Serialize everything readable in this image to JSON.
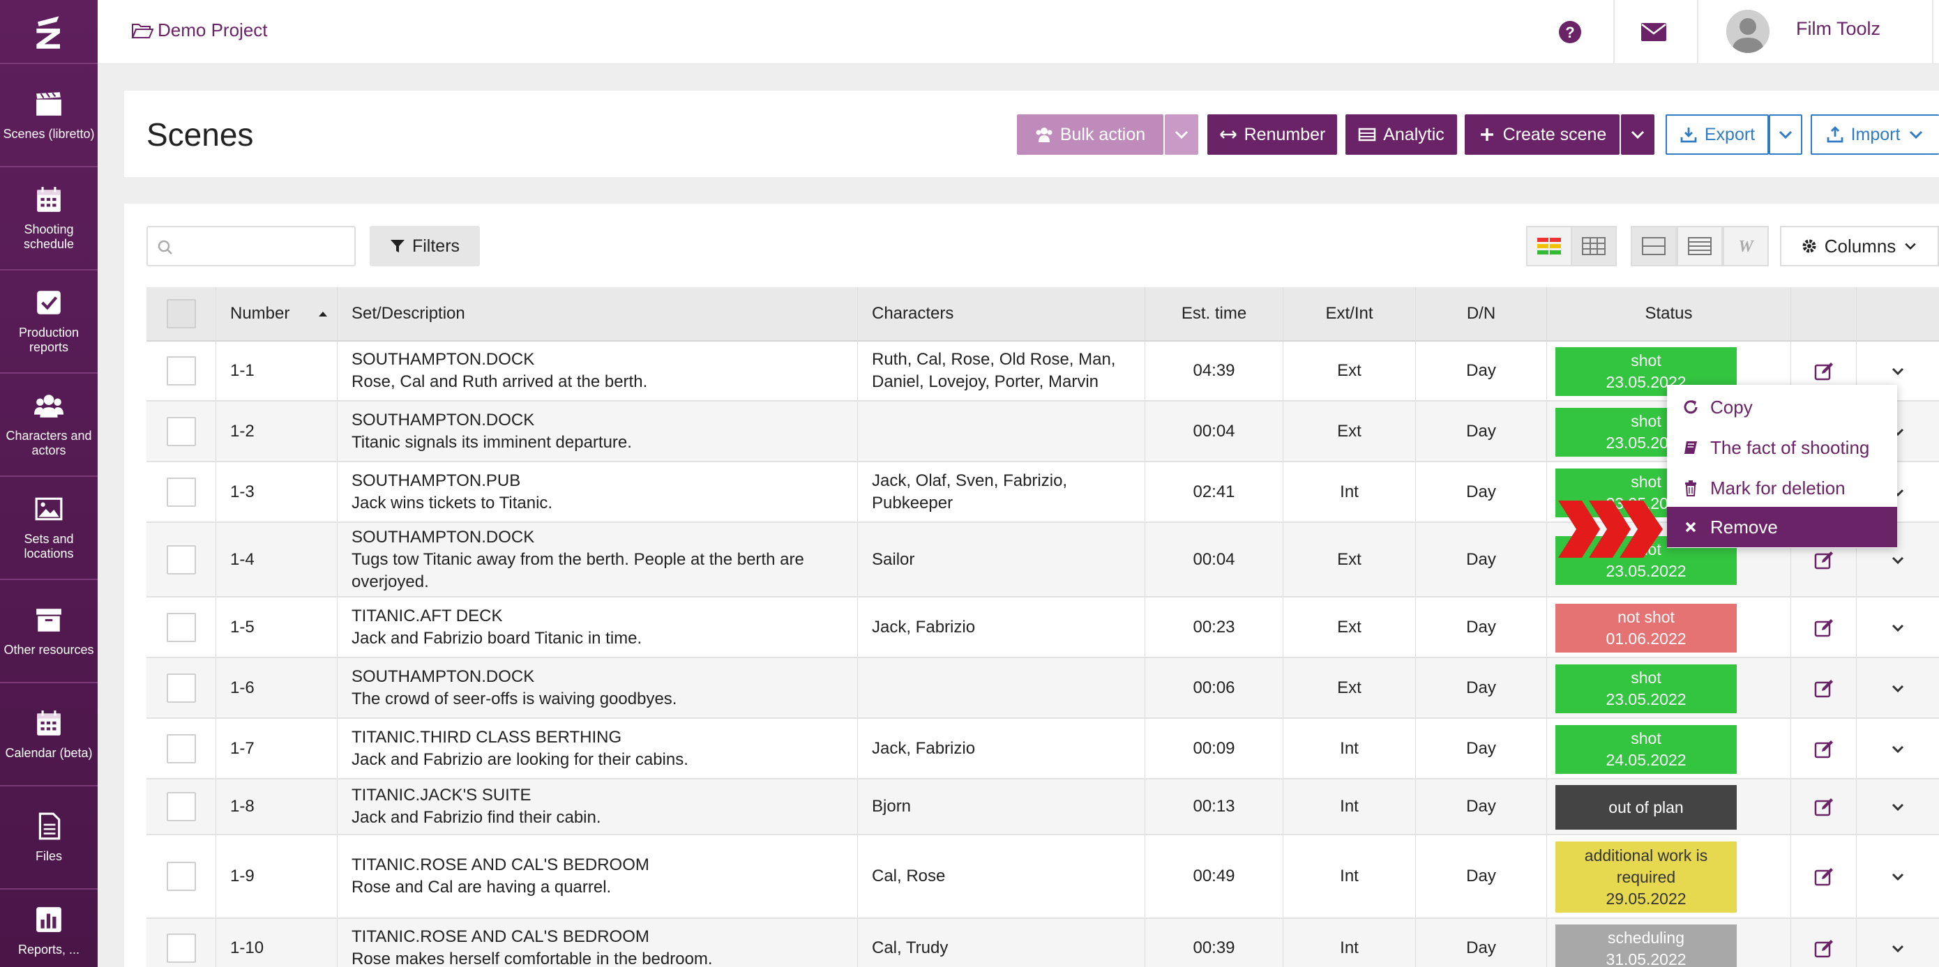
{
  "sidebar": {
    "items": [
      {
        "label": "Scenes (libretto)",
        "icon": "clapperboard-icon"
      },
      {
        "label": "Shooting schedule",
        "icon": "calendar-icon"
      },
      {
        "label": "Production reports",
        "icon": "checkbox-icon"
      },
      {
        "label": "Characters and actors",
        "icon": "users-icon"
      },
      {
        "label": "Sets and locations",
        "icon": "image-icon"
      },
      {
        "label": "Other resources",
        "icon": "archive-icon"
      },
      {
        "label": "Calendar (beta)",
        "icon": "calendar-icon"
      },
      {
        "label": "Files",
        "icon": "file-icon"
      },
      {
        "label": "Reports, ...",
        "icon": "bar-chart-icon"
      }
    ]
  },
  "topbar": {
    "project": "Demo Project",
    "user": "Film Toolz"
  },
  "page": {
    "title": "Scenes",
    "buttons": {
      "bulk": "Bulk action",
      "renumber": "Renumber",
      "analytic": "Analytic",
      "create": "Create scene",
      "export": "Export",
      "import": "Import"
    }
  },
  "toolbar": {
    "search_placeholder": "",
    "filters": "Filters",
    "columns": "Columns"
  },
  "table": {
    "headers": [
      "Number",
      "Set/Description",
      "Characters",
      "Est. time",
      "Ext/Int",
      "D/N",
      "Status"
    ],
    "rows": [
      {
        "number": "1-1",
        "set": "SOUTHAMPTON.DOCK",
        "desc": "Rose, Cal and Ruth arrived at the berth.",
        "chars1": "Ruth, Cal, Rose, Old Rose, Man,",
        "chars2": "Daniel, Lovejoy, Porter, Marvin",
        "time": "04:39",
        "extint": "Ext",
        "dn": "Day",
        "status": "shot",
        "date": "23.05.2022",
        "status_color": "#33c440"
      },
      {
        "number": "1-2",
        "set": "SOUTHAMPTON.DOCK",
        "desc": "Titanic signals its imminent departure.",
        "chars1": "",
        "chars2": "",
        "time": "00:04",
        "extint": "Ext",
        "dn": "Day",
        "status": "shot",
        "date": "23.05.2022",
        "status_color": "#33c440"
      },
      {
        "number": "1-3",
        "set": "SOUTHAMPTON.PUB",
        "desc": "Jack wins tickets to Titanic.",
        "chars1": "Jack, Olaf, Sven, Fabrizio,",
        "chars2": "Pubkeeper",
        "time": "02:41",
        "extint": "Int",
        "dn": "Day",
        "status": "shot",
        "date": "23.05.2022",
        "status_color": "#33c440"
      },
      {
        "number": "1-4",
        "set": "SOUTHAMPTON.DOCK",
        "desc": "Tugs tow Titanic away from the berth. People at the berth are",
        "desc2": "overjoyed.",
        "chars1": "Sailor",
        "chars2": "",
        "time": "00:04",
        "extint": "Ext",
        "dn": "Day",
        "status": "shot",
        "date": "23.05.2022",
        "status_color": "#33c440"
      },
      {
        "number": "1-5",
        "set": "TITANIC.AFT DECK",
        "desc": "Jack and Fabrizio board Titanic in time.",
        "chars1": "Jack, Fabrizio",
        "chars2": "",
        "time": "00:23",
        "extint": "Ext",
        "dn": "Day",
        "status": "not shot",
        "date": "01.06.2022",
        "status_color": "#e57373"
      },
      {
        "number": "1-6",
        "set": "SOUTHAMPTON.DOCK",
        "desc": "The crowd of seer-offs is waiving goodbyes.",
        "chars1": "",
        "chars2": "",
        "time": "00:06",
        "extint": "Ext",
        "dn": "Day",
        "status": "shot",
        "date": "23.05.2022",
        "status_color": "#33c440"
      },
      {
        "number": "1-7",
        "set": "TITANIC.THIRD CLASS BERTHING",
        "desc": "Jack and Fabrizio are looking for their cabins.",
        "chars1": "Jack, Fabrizio",
        "chars2": "",
        "time": "00:09",
        "extint": "Int",
        "dn": "Day",
        "status": "shot",
        "date": "24.05.2022",
        "status_color": "#33c440"
      },
      {
        "number": "1-8",
        "set": "TITANIC.JACK'S SUITE",
        "desc": "Jack and Fabrizio find their cabin.",
        "chars1": "Bjorn",
        "chars2": "",
        "time": "00:13",
        "extint": "Int",
        "dn": "Day",
        "status": "out of plan",
        "date": "",
        "status_color": "#444444"
      },
      {
        "number": "1-9",
        "set": "TITANIC.ROSE AND CAL'S BEDROOM",
        "desc": "Rose and Cal are having a quarrel.",
        "chars1": "Cal, Rose",
        "chars2": "",
        "time": "00:49",
        "extint": "Int",
        "dn": "Day",
        "status": "additional work is",
        "status2": "required",
        "date": "29.05.2022",
        "status_color": "#e6d84f"
      },
      {
        "number": "1-10",
        "set": "TITANIC.ROSE AND CAL'S BEDROOM",
        "desc": "Rose makes herself comfortable in the bedroom.",
        "chars1": "Cal, Trudy",
        "chars2": "",
        "time": "00:39",
        "extint": "Int",
        "dn": "Day",
        "status": "scheduling",
        "date": "31.05.2022",
        "status_color": "#a8a8a8"
      }
    ]
  },
  "context_menu": {
    "items": [
      "Copy",
      "The fact of shooting",
      "Mark for deletion",
      "Remove"
    ],
    "active": "Remove"
  }
}
